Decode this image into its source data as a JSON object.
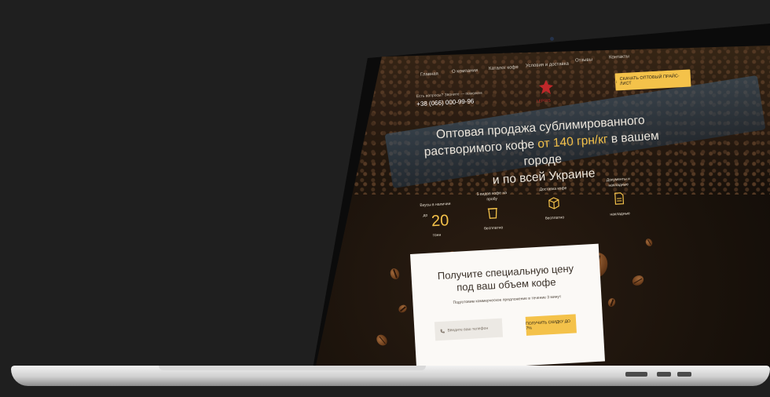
{
  "nav": {
    "items": [
      "Главная",
      "О компании",
      "Каталог кофе",
      "Условия и доставка",
      "Отзывы",
      "Контакты"
    ]
  },
  "header": {
    "phone_label": "Есть вопросы? Звоните — поможем",
    "phone_number": "+38 (066) 000-99-96",
    "logo_text": "LEPRIS",
    "price_button": "СКАЧАТЬ ОПТОВЫЙ ПРАЙС-ЛИСТ"
  },
  "hero": {
    "line1": "Оптовая продажа сублимированного",
    "line2_before": "растворимого кофе ",
    "line2_accent": "от 140 грн/кг",
    "line2_after": " в вашем городе",
    "line3": "и по всей Украине"
  },
  "features": [
    {
      "title": "Вкусы в наличии",
      "prefix": "до",
      "value": "20",
      "note": "тонн"
    },
    {
      "title": "5 видов кофе на пробу",
      "icon": "cup-icon",
      "note": "бесплатно"
    },
    {
      "title": "Доставка кофе",
      "icon": "box-icon",
      "note": "бесплатно"
    },
    {
      "title": "Документы и накладные",
      "icon": "document-icon",
      "note": "накладные"
    }
  ],
  "form": {
    "title_line1": "Получите специальную цену",
    "title_line2": "под ваш объем кофе",
    "subtitle": "Подготовим коммерческое предложение в течение 3 минут",
    "input_placeholder": "Введите ваш телефон",
    "submit_label": "ПОЛУЧИТЬ СКИДКУ ДО 7%"
  },
  "colors": {
    "accent": "#f4c24a",
    "background": "#1f1f1f",
    "logo_red": "#c0282a"
  }
}
